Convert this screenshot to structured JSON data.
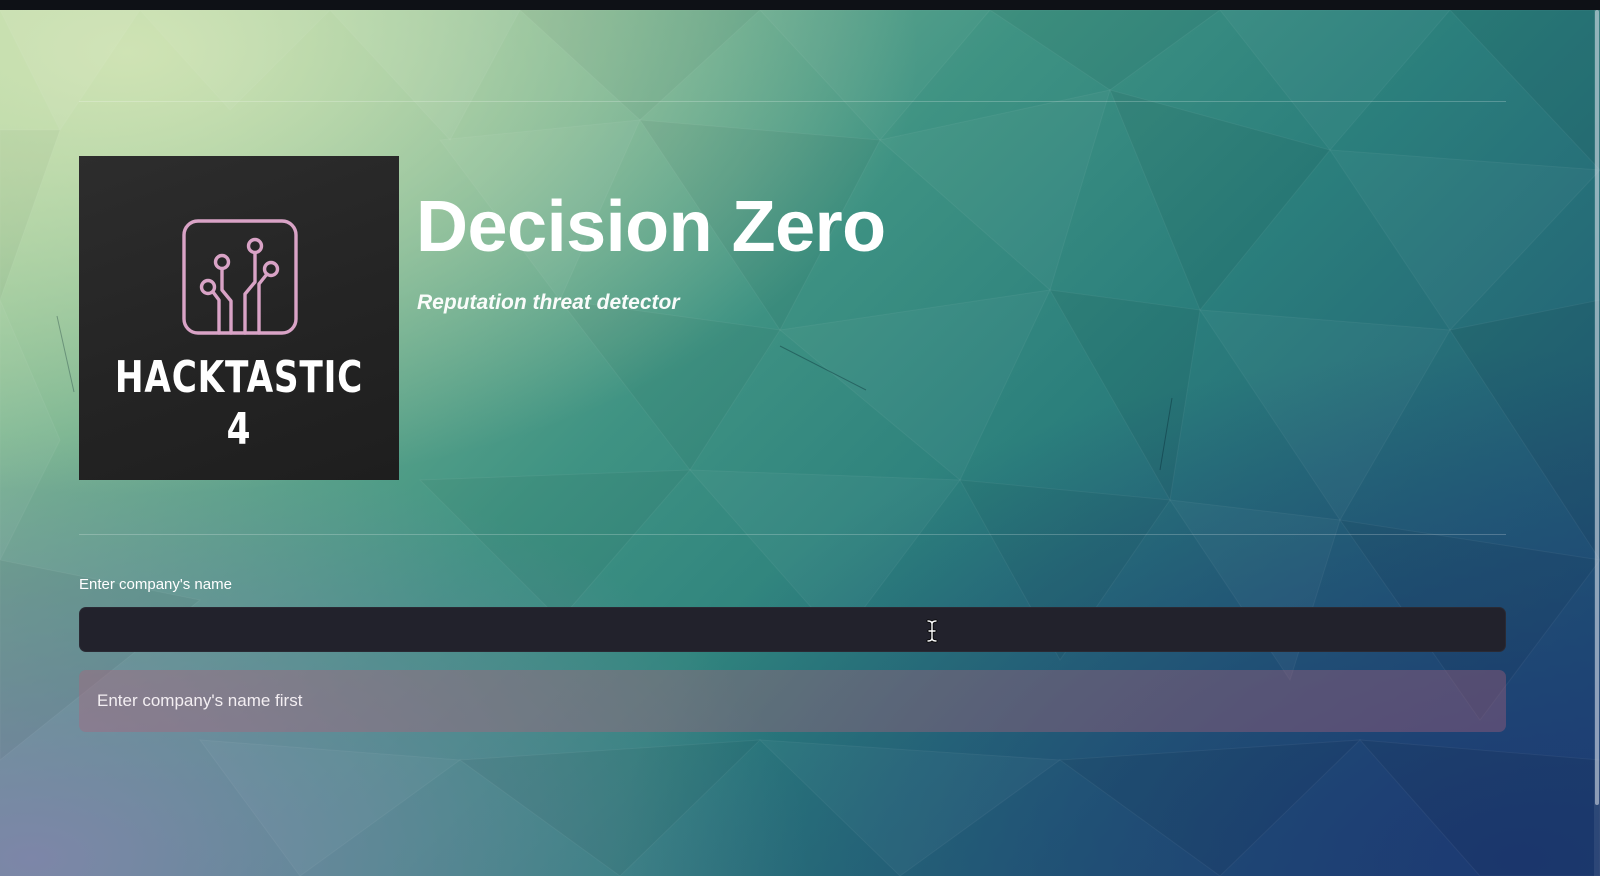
{
  "theme": {
    "accent_logo": "#d9a3c6",
    "input_background": "#22222c",
    "alert_background": "#b0607a"
  },
  "header": {
    "logo_text": "HACKTASTIC 4",
    "logo_icon": "circuit-board-icon",
    "title": "Decision Zero",
    "subtitle": "Reputation threat detector"
  },
  "form": {
    "company_label": "Enter company's name",
    "company_value": "",
    "cursor_icon": "text-cursor-icon"
  },
  "alert": {
    "message": "Enter company's name first",
    "kind": "error"
  }
}
